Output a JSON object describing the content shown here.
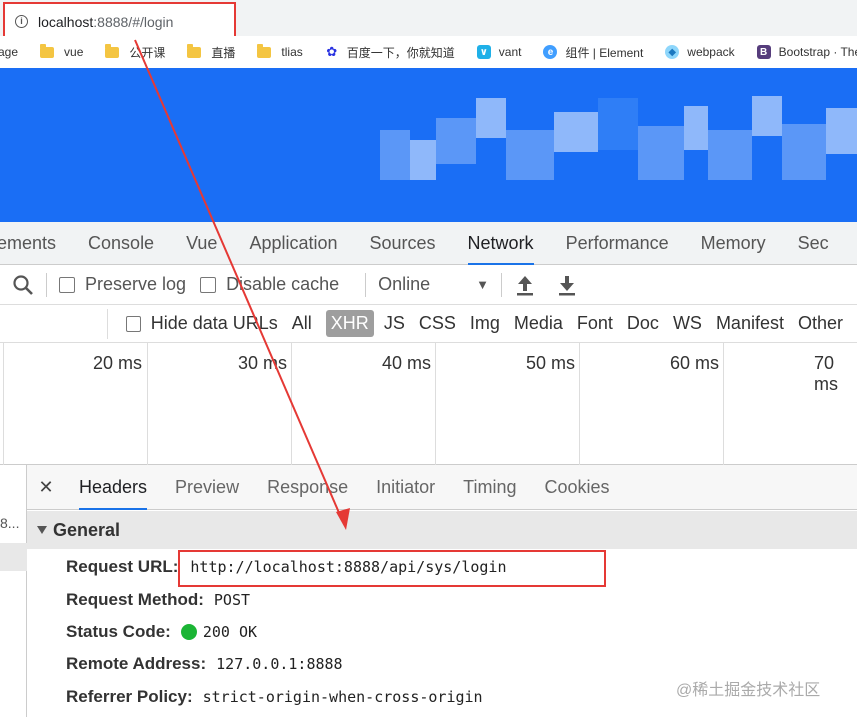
{
  "address": {
    "host": "localhost",
    "rest": ":8888/#/login"
  },
  "bookmarks": [
    {
      "label": "age",
      "icon": "none"
    },
    {
      "label": "vue",
      "icon": "folder-icon"
    },
    {
      "label": "公开课",
      "icon": "folder-icon"
    },
    {
      "label": "直播",
      "icon": "folder-icon"
    },
    {
      "label": "tlias",
      "icon": "folder-icon"
    },
    {
      "label": "百度一下，你就知道",
      "icon": "baidu-paw-icon"
    },
    {
      "label": "vant",
      "icon": "vant-logo-icon"
    },
    {
      "label": "组件 | Element",
      "icon": "element-logo-icon"
    },
    {
      "label": "webpack",
      "icon": "webpack-logo-icon"
    },
    {
      "label": "Bootstrap · The m",
      "icon": "bootstrap-logo-icon"
    }
  ],
  "devtools_tabs": [
    "ements",
    "Console",
    "Vue",
    "Application",
    "Sources",
    "Network",
    "Performance",
    "Memory",
    "Sec"
  ],
  "active_devtools_tab": "Network",
  "toolbar": {
    "preserve_log": "Preserve log",
    "disable_cache": "Disable cache",
    "throttle": "Online"
  },
  "filters": {
    "hide_data_urls": "Hide data URLs",
    "types": [
      "All",
      "XHR",
      "JS",
      "CSS",
      "Img",
      "Media",
      "Font",
      "Doc",
      "WS",
      "Manifest",
      "Other"
    ],
    "selected": "XHR"
  },
  "timeline_labels": [
    "20 ms",
    "30 ms",
    "40 ms",
    "50 ms",
    "60 ms",
    "70 ms"
  ],
  "request_list": {
    "row_text": "8..."
  },
  "detail_tabs": [
    "Headers",
    "Preview",
    "Response",
    "Initiator",
    "Timing",
    "Cookies"
  ],
  "active_detail_tab": "Headers",
  "general": {
    "title": "General",
    "rows": [
      {
        "key": "Request URL:",
        "value": "http://localhost:8888/api/sys/login"
      },
      {
        "key": "Request Method:",
        "value": "POST"
      },
      {
        "key": "Status Code:",
        "value": "200 OK"
      },
      {
        "key": "Remote Address:",
        "value": "127.0.0.1:8888"
      },
      {
        "key": "Referrer Policy:",
        "value": "strict-origin-when-cross-origin"
      }
    ]
  },
  "watermark": "@稀土掘金技术社区",
  "colors": {
    "annotation_red": "#e53935",
    "status_green": "#1bb535",
    "page_blue": "#1a6ef5",
    "accent_blue": "#1a73e8"
  }
}
